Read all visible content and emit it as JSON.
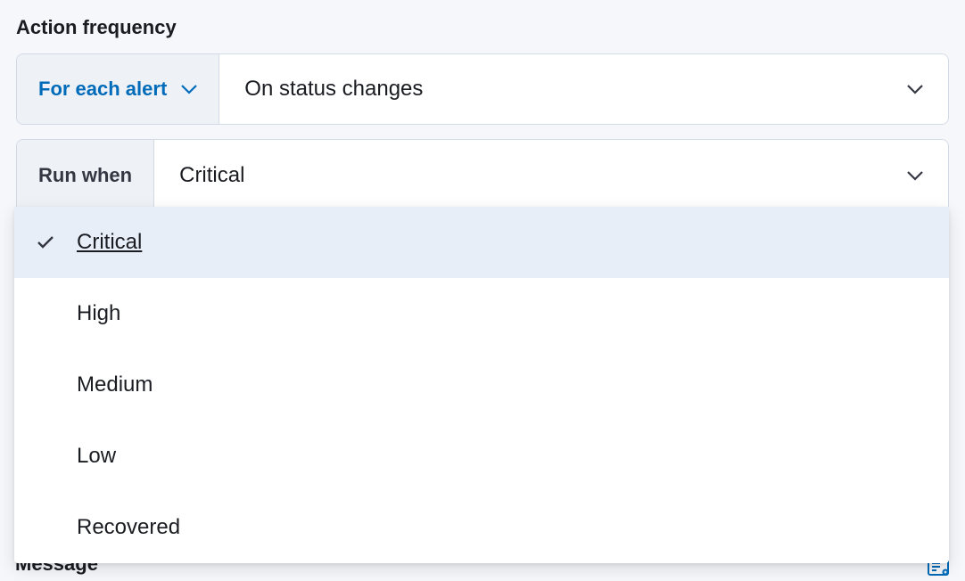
{
  "section_title": "Action frequency",
  "row1": {
    "prefix_label": "For each alert",
    "value": "On status changes"
  },
  "row2": {
    "prefix_label": "Run when",
    "value": "Critical"
  },
  "dropdown": {
    "options": [
      {
        "label": "Critical",
        "selected": true
      },
      {
        "label": "High",
        "selected": false
      },
      {
        "label": "Medium",
        "selected": false
      },
      {
        "label": "Low",
        "selected": false
      },
      {
        "label": "Recovered",
        "selected": false
      }
    ]
  },
  "message_label": "Message"
}
